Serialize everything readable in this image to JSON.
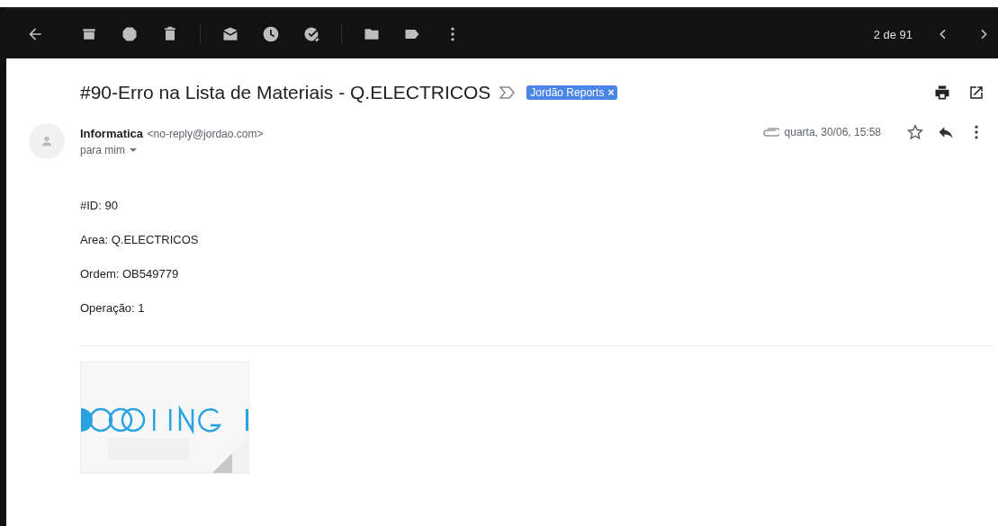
{
  "toolbar": {
    "pager": "2 de 91"
  },
  "message": {
    "subject": "#90-Erro na Lista de Materiais - Q.ELECTRICOS",
    "label": {
      "text": "Jordão Reports",
      "remove": "×"
    },
    "sender": {
      "name": "Informatica",
      "email": "<no-reply@jordao.com>",
      "recipient": "para mim"
    },
    "date": "quarta, 30/06, 15:58",
    "starred": false,
    "body": [
      "#ID: 90",
      "Area: Q.ELECTRICOS",
      "Ordem: OB549779",
      "Operação: 1"
    ]
  }
}
